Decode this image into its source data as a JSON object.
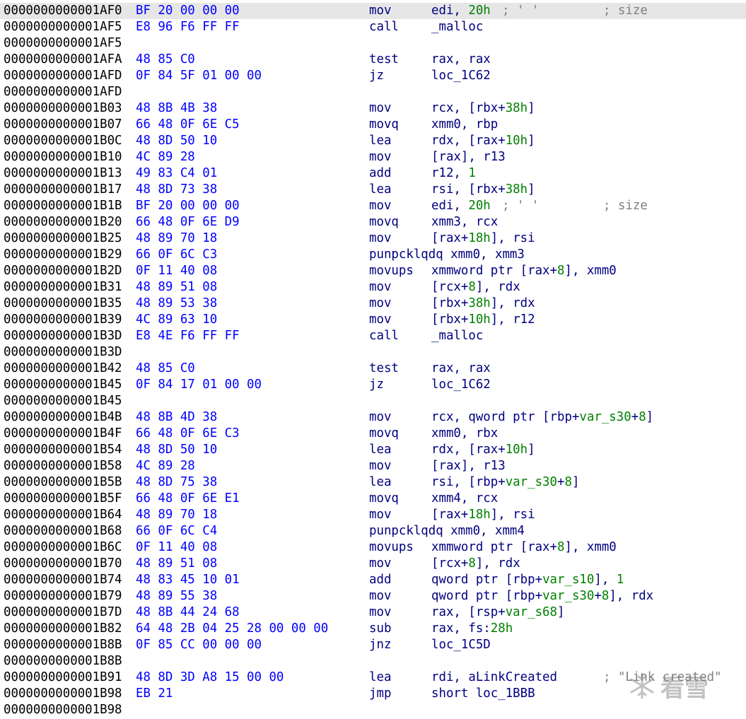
{
  "rows": [
    {
      "addr": "0000000000001AF0",
      "bytes": "BF 20 00 00 00",
      "mn": "mov",
      "ops": [
        {
          "t": "edi, "
        },
        {
          "t": "20h",
          "n": true
        }
      ],
      "cmt": "; ' '",
      "cmt2": "; size",
      "selected": true
    },
    {
      "addr": "0000000000001AF5",
      "bytes": "E8 96 F6 FF FF",
      "mn": "call",
      "ops": [
        {
          "t": "_malloc"
        }
      ]
    },
    {
      "addr": "0000000000001AF5"
    },
    {
      "addr": "0000000000001AFA",
      "bytes": "48 85 C0",
      "mn": "test",
      "ops": [
        {
          "t": "rax, rax"
        }
      ]
    },
    {
      "addr": "0000000000001AFD",
      "bytes": "0F 84 5F 01 00 00",
      "mn": "jz",
      "ops": [
        {
          "t": "loc_1C62"
        }
      ]
    },
    {
      "addr": "0000000000001AFD"
    },
    {
      "addr": "0000000000001B03",
      "bytes": "48 8B 4B 38",
      "mn": "mov",
      "ops": [
        {
          "t": "rcx, [rbx+"
        },
        {
          "t": "38h",
          "n": true
        },
        {
          "t": "]"
        }
      ]
    },
    {
      "addr": "0000000000001B07",
      "bytes": "66 48 0F 6E C5",
      "mn": "movq",
      "ops": [
        {
          "t": "xmm0, rbp"
        }
      ]
    },
    {
      "addr": "0000000000001B0C",
      "bytes": "48 8D 50 10",
      "mn": "lea",
      "ops": [
        {
          "t": "rdx, [rax+"
        },
        {
          "t": "10h",
          "n": true
        },
        {
          "t": "]"
        }
      ]
    },
    {
      "addr": "0000000000001B10",
      "bytes": "4C 89 28",
      "mn": "mov",
      "ops": [
        {
          "t": "[rax], r13"
        }
      ]
    },
    {
      "addr": "0000000000001B13",
      "bytes": "49 83 C4 01",
      "mn": "add",
      "ops": [
        {
          "t": "r12, "
        },
        {
          "t": "1",
          "n": true
        }
      ]
    },
    {
      "addr": "0000000000001B17",
      "bytes": "48 8D 73 38",
      "mn": "lea",
      "ops": [
        {
          "t": "rsi, [rbx+"
        },
        {
          "t": "38h",
          "n": true
        },
        {
          "t": "]"
        }
      ]
    },
    {
      "addr": "0000000000001B1B",
      "bytes": "BF 20 00 00 00",
      "mn": "mov",
      "ops": [
        {
          "t": "edi, "
        },
        {
          "t": "20h",
          "n": true
        }
      ],
      "cmt": "; ' '",
      "cmt2": "; size"
    },
    {
      "addr": "0000000000001B20",
      "bytes": "66 48 0F 6E D9",
      "mn": "movq",
      "ops": [
        {
          "t": "xmm3, rcx"
        }
      ]
    },
    {
      "addr": "0000000000001B25",
      "bytes": "48 89 70 18",
      "mn": "mov",
      "ops": [
        {
          "t": "[rax+"
        },
        {
          "t": "18h",
          "n": true
        },
        {
          "t": "], rsi"
        }
      ]
    },
    {
      "addr": "0000000000001B29",
      "bytes": "66 0F 6C C3",
      "mn": "punpcklqdq xmm0, xmm3",
      "ops": []
    },
    {
      "addr": "0000000000001B2D",
      "bytes": "0F 11 40 08",
      "mn": "movups",
      "ops": [
        {
          "t": "xmmword ptr [rax+"
        },
        {
          "t": "8",
          "n": true
        },
        {
          "t": "], xmm0"
        }
      ]
    },
    {
      "addr": "0000000000001B31",
      "bytes": "48 89 51 08",
      "mn": "mov",
      "ops": [
        {
          "t": "[rcx+"
        },
        {
          "t": "8",
          "n": true
        },
        {
          "t": "], rdx"
        }
      ]
    },
    {
      "addr": "0000000000001B35",
      "bytes": "48 89 53 38",
      "mn": "mov",
      "ops": [
        {
          "t": "[rbx+"
        },
        {
          "t": "38h",
          "n": true
        },
        {
          "t": "], rdx"
        }
      ]
    },
    {
      "addr": "0000000000001B39",
      "bytes": "4C 89 63 10",
      "mn": "mov",
      "ops": [
        {
          "t": "[rbx+"
        },
        {
          "t": "10h",
          "n": true
        },
        {
          "t": "], r12"
        }
      ]
    },
    {
      "addr": "0000000000001B3D",
      "bytes": "E8 4E F6 FF FF",
      "mn": "call",
      "ops": [
        {
          "t": "_malloc"
        }
      ]
    },
    {
      "addr": "0000000000001B3D"
    },
    {
      "addr": "0000000000001B42",
      "bytes": "48 85 C0",
      "mn": "test",
      "ops": [
        {
          "t": "rax, rax"
        }
      ]
    },
    {
      "addr": "0000000000001B45",
      "bytes": "0F 84 17 01 00 00",
      "mn": "jz",
      "ops": [
        {
          "t": "loc_1C62"
        }
      ]
    },
    {
      "addr": "0000000000001B45"
    },
    {
      "addr": "0000000000001B4B",
      "bytes": "48 8B 4D 38",
      "mn": "mov",
      "ops": [
        {
          "t": "rcx, qword ptr [rbp+"
        },
        {
          "t": "var_s30",
          "n": true
        },
        {
          "t": "+"
        },
        {
          "t": "8",
          "n": true
        },
        {
          "t": "]"
        }
      ]
    },
    {
      "addr": "0000000000001B4F",
      "bytes": "66 48 0F 6E C3",
      "mn": "movq",
      "ops": [
        {
          "t": "xmm0, rbx"
        }
      ]
    },
    {
      "addr": "0000000000001B54",
      "bytes": "48 8D 50 10",
      "mn": "lea",
      "ops": [
        {
          "t": "rdx, [rax+"
        },
        {
          "t": "10h",
          "n": true
        },
        {
          "t": "]"
        }
      ]
    },
    {
      "addr": "0000000000001B58",
      "bytes": "4C 89 28",
      "mn": "mov",
      "ops": [
        {
          "t": "[rax], r13"
        }
      ]
    },
    {
      "addr": "0000000000001B5B",
      "bytes": "48 8D 75 38",
      "mn": "lea",
      "ops": [
        {
          "t": "rsi, [rbp+"
        },
        {
          "t": "var_s30",
          "n": true
        },
        {
          "t": "+"
        },
        {
          "t": "8",
          "n": true
        },
        {
          "t": "]"
        }
      ]
    },
    {
      "addr": "0000000000001B5F",
      "bytes": "66 48 0F 6E E1",
      "mn": "movq",
      "ops": [
        {
          "t": "xmm4, rcx"
        }
      ]
    },
    {
      "addr": "0000000000001B64",
      "bytes": "48 89 70 18",
      "mn": "mov",
      "ops": [
        {
          "t": "[rax+"
        },
        {
          "t": "18h",
          "n": true
        },
        {
          "t": "], rsi"
        }
      ]
    },
    {
      "addr": "0000000000001B68",
      "bytes": "66 0F 6C C4",
      "mn": "punpcklqdq xmm0, xmm4",
      "ops": []
    },
    {
      "addr": "0000000000001B6C",
      "bytes": "0F 11 40 08",
      "mn": "movups",
      "ops": [
        {
          "t": "xmmword ptr [rax+"
        },
        {
          "t": "8",
          "n": true
        },
        {
          "t": "], xmm0"
        }
      ]
    },
    {
      "addr": "0000000000001B70",
      "bytes": "48 89 51 08",
      "mn": "mov",
      "ops": [
        {
          "t": "[rcx+"
        },
        {
          "t": "8",
          "n": true
        },
        {
          "t": "], rdx"
        }
      ]
    },
    {
      "addr": "0000000000001B74",
      "bytes": "48 83 45 10 01",
      "mn": "add",
      "ops": [
        {
          "t": "qword ptr [rbp+"
        },
        {
          "t": "var_s10",
          "n": true
        },
        {
          "t": "], "
        },
        {
          "t": "1",
          "n": true
        }
      ]
    },
    {
      "addr": "0000000000001B79",
      "bytes": "48 89 55 38",
      "mn": "mov",
      "ops": [
        {
          "t": "qword ptr [rbp+"
        },
        {
          "t": "var_s30",
          "n": true
        },
        {
          "t": "+"
        },
        {
          "t": "8",
          "n": true
        },
        {
          "t": "], rdx"
        }
      ]
    },
    {
      "addr": "0000000000001B7D",
      "bytes": "48 8B 44 24 68",
      "mn": "mov",
      "ops": [
        {
          "t": "rax, [rsp+"
        },
        {
          "t": "var_s68",
          "n": true
        },
        {
          "t": "]"
        }
      ]
    },
    {
      "addr": "0000000000001B82",
      "bytes": "64 48 2B 04 25 28 00 00 00",
      "mn": "sub",
      "ops": [
        {
          "t": "rax, fs:"
        },
        {
          "t": "28h",
          "n": true
        }
      ]
    },
    {
      "addr": "0000000000001B8B",
      "bytes": "0F 85 CC 00 00 00",
      "mn": "jnz",
      "ops": [
        {
          "t": "loc_1C5D"
        }
      ]
    },
    {
      "addr": "0000000000001B8B"
    },
    {
      "addr": "0000000000001B91",
      "bytes": "48 8D 3D A8 15 00 00",
      "mn": "lea",
      "ops": [
        {
          "t": "rdi, aLinkCreated"
        }
      ],
      "cmt2": "; \"Link created\""
    },
    {
      "addr": "0000000000001B98",
      "bytes": "EB 21",
      "mn": "jmp",
      "ops": [
        {
          "t": "short loc_1BBB"
        }
      ]
    },
    {
      "addr": "0000000000001B98"
    }
  ],
  "watermark": {
    "text": "看雪",
    "icon": "snowflake-icon"
  }
}
